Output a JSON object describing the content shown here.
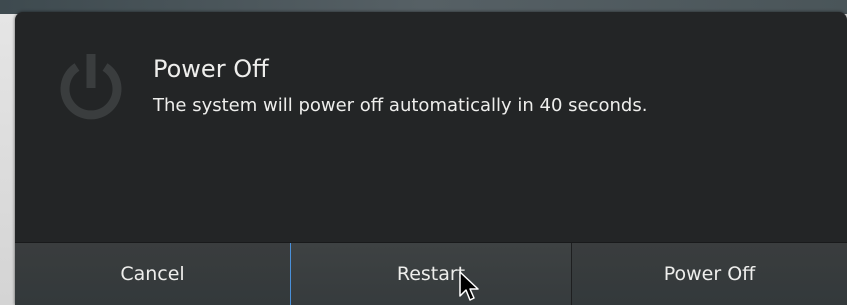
{
  "dialog": {
    "title": "Power Off",
    "message": "The system will power off automatically in 40 seconds.",
    "icon": "power-icon"
  },
  "buttons": {
    "cancel_label": "Cancel",
    "restart_label": "Restart",
    "power_off_label": "Power Off"
  },
  "colors": {
    "dialog_background": "#232526",
    "button_background": "#353a3c",
    "text": "#eeeeec",
    "focus_border": "#4a90d9"
  },
  "pointer": "arrow-cursor"
}
